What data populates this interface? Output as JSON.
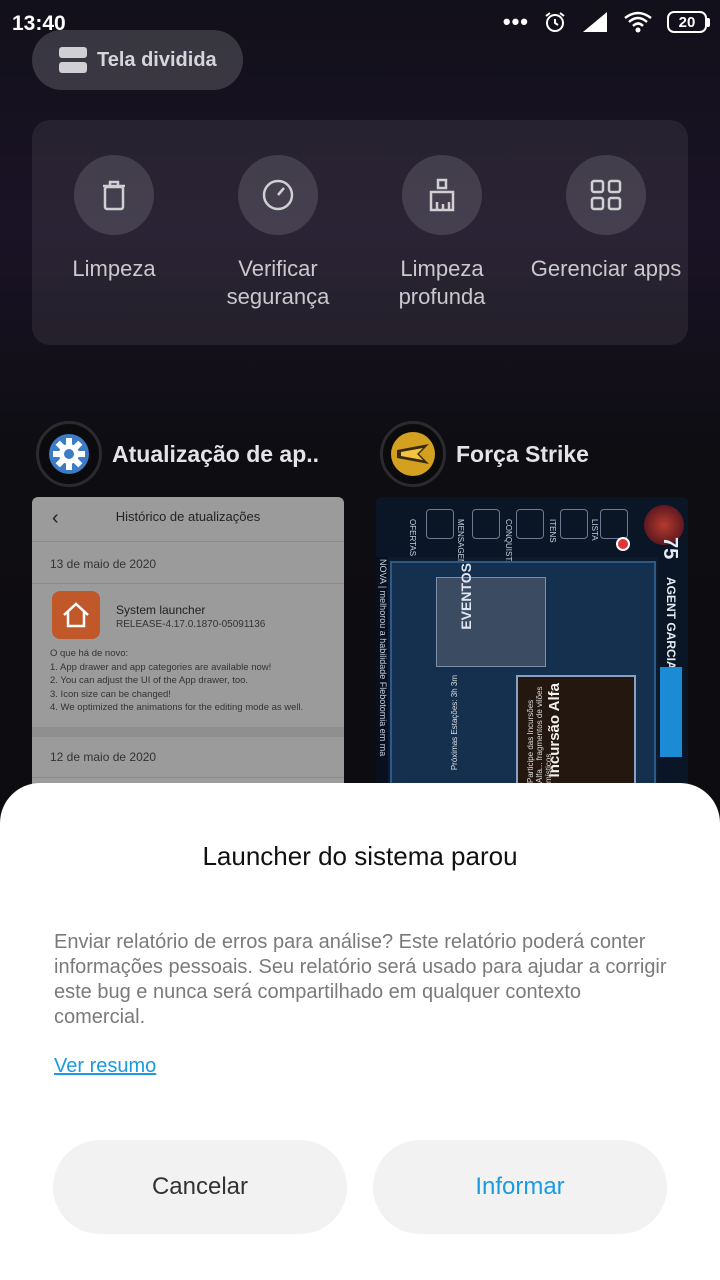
{
  "status_bar": {
    "time": "13:40",
    "icons": [
      "more-dots-icon",
      "alarm-icon",
      "signal-icon",
      "wifi-icon"
    ],
    "battery": "20"
  },
  "split_screen": {
    "icon": "split-screen-icon",
    "label": "Tela dividida"
  },
  "tools": [
    {
      "icon": "trash-icon",
      "label": "Limpeza"
    },
    {
      "icon": "security-check-icon",
      "label": "Verificar segurança"
    },
    {
      "icon": "deep-clean-icon",
      "label": "Limpeza profunda"
    },
    {
      "icon": "grid-apps-icon",
      "label": "Gerenciar apps"
    }
  ],
  "recent_apps": [
    {
      "name": "Atualização de ap..",
      "icon": "gear-icon",
      "preview": {
        "title": "Histórico de atualizações",
        "date1": "13 de maio de 2020",
        "app_name": "System launcher",
        "release": "RELEASE-4.17.0.1870-05091136",
        "notes_header": "O que há de novo:",
        "notes": [
          "1. App drawer and app categories are available now!",
          "2. You can adjust the UI of the App drawer, too.",
          "3. Icon size can be changed!",
          "4. We optimized the animations for the editing mode as well."
        ],
        "date2": "12 de maio de 2020"
      }
    },
    {
      "name": "Força Strike",
      "icon": "game-logo-icon",
      "preview": {
        "tabs": [
          "OFERTAS",
          "MENSAGENS",
          "CONQUISTAS",
          "ITENS",
          "LISTA"
        ],
        "ticker": "NOVA | melhorou a habilidade Flebotomia em ma",
        "events": "EVENTOS",
        "next_stage": "Próximas Estações: 3h 3m",
        "incursion_title": "Incursão Alfa",
        "incursion_text": "Participe das Incursões Alfa... fragmentos de vilões místicos",
        "level": "75",
        "agent": "AGENT GARCIA"
      }
    }
  ],
  "dialog": {
    "title": "Launcher do sistema parou",
    "message": "Enviar relatório de erros para análise? Este relatório poderá conter informações pessoais. Seu relatório será usado para ajudar a corrigir este bug e nunca será compartilhado em qualquer contexto comercial.",
    "link": "Ver resumo",
    "cancel": "Cancelar",
    "report": "Informar",
    "accent_color": "#1a9ae0"
  }
}
